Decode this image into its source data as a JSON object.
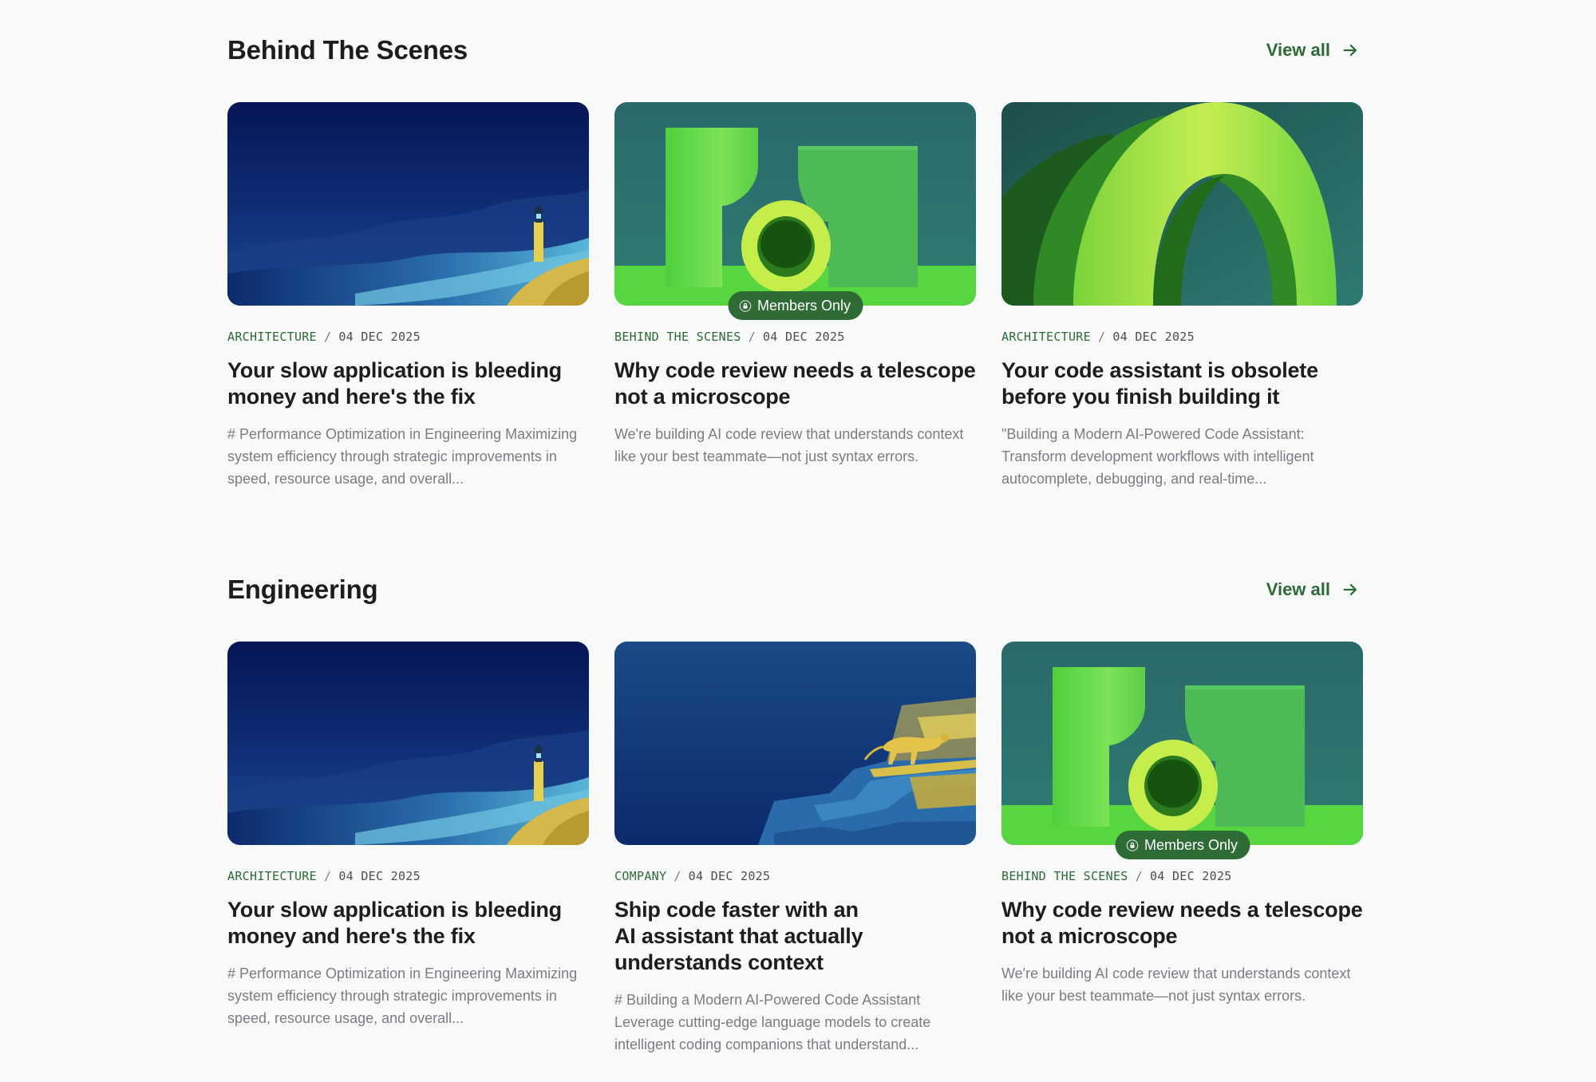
{
  "sections": [
    {
      "title": "Behind The Scenes",
      "view_all": "View all",
      "cards": [
        {
          "image": "lighthouse-illustration",
          "category": "ARCHITECTURE",
          "separator": "/",
          "date": "04 DEC 2025",
          "title": "Your slow application is bleeding money and here's the fix",
          "excerpt": "# Performance Optimization in Engineering Maximizing system efficiency through strategic improvements in speed, resource usage, and overall..."
        },
        {
          "image": "green-telescope-illustration",
          "badge": "Members Only",
          "category": "BEHIND THE SCENES",
          "separator": "/",
          "date": "04 DEC 2025",
          "title": "Why code review needs a telescope not a microscope",
          "excerpt": "We're building AI code review that understands context like your best teammate—not just syntax errors."
        },
        {
          "image": "green-arch-illustration",
          "category": "ARCHITECTURE",
          "separator": "/",
          "date": "04 DEC 2025",
          "title": "Your code assistant is obsolete before you finish building it",
          "excerpt": "\"Building a Modern AI-Powered Code Assistant: Transform development workflows with intelligent autocomplete, debugging, and real-time..."
        }
      ]
    },
    {
      "title": "Engineering",
      "view_all": "View all",
      "cards": [
        {
          "image": "lighthouse-illustration",
          "category": "ARCHITECTURE",
          "separator": "/",
          "date": "04 DEC 2025",
          "title": "Your slow application is bleeding money and here's the fix",
          "excerpt": "# Performance Optimization in Engineering Maximizing system efficiency through strategic improvements in speed, resource usage, and overall..."
        },
        {
          "image": "cheetah-steps-illustration",
          "category": "COMPANY",
          "separator": "/",
          "date": "04 DEC 2025",
          "title": "Ship code faster with an AI assistant that actually understands context",
          "excerpt": "# Building a Modern AI-Powered Code Assistant Leverage cutting-edge language models to create intelligent coding companions that understand..."
        },
        {
          "image": "green-telescope-illustration",
          "badge": "Members Only",
          "category": "BEHIND THE SCENES",
          "separator": "/",
          "date": "04 DEC 2025",
          "title": "Why code review needs a telescope not a microscope",
          "excerpt": "We're building AI code review that understands context like your best teammate—not just syntax errors."
        }
      ]
    }
  ],
  "colors": {
    "background": "#f8f9f9",
    "accent": "#2d6a35",
    "badge": "#2f6b35",
    "title": "#1c1d1f",
    "muted": "#7a7d82"
  },
  "icons": {
    "view_all": "arrow-right-icon",
    "badge": "lock-icon"
  }
}
